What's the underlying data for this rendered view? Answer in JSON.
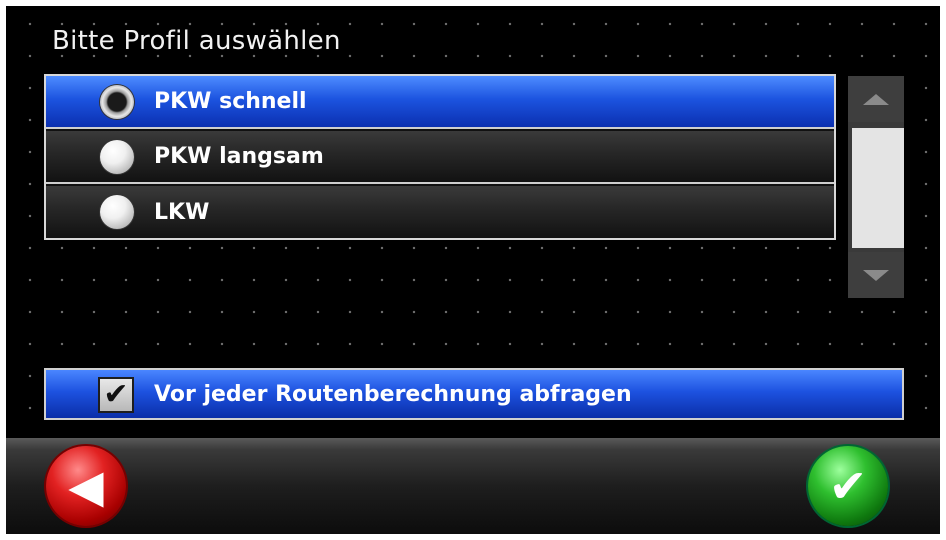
{
  "title": "Bitte Profil auswählen",
  "profiles": [
    {
      "label": "PKW schnell",
      "selected": true
    },
    {
      "label": "PKW langsam",
      "selected": false
    },
    {
      "label": "LKW",
      "selected": false
    }
  ],
  "scrollbar": {
    "up_icon": "triangle-up-icon",
    "down_icon": "triangle-down-icon"
  },
  "checkbox": {
    "label": "Vor jeder Routenberechnung abfragen",
    "checked": true,
    "glyph": "✔"
  },
  "buttons": {
    "back_glyph": "◀",
    "ok_glyph": "✔"
  },
  "colors": {
    "selection_blue": "#1c54e0",
    "back_red": "#e22222",
    "ok_green": "#2fbf2f"
  }
}
